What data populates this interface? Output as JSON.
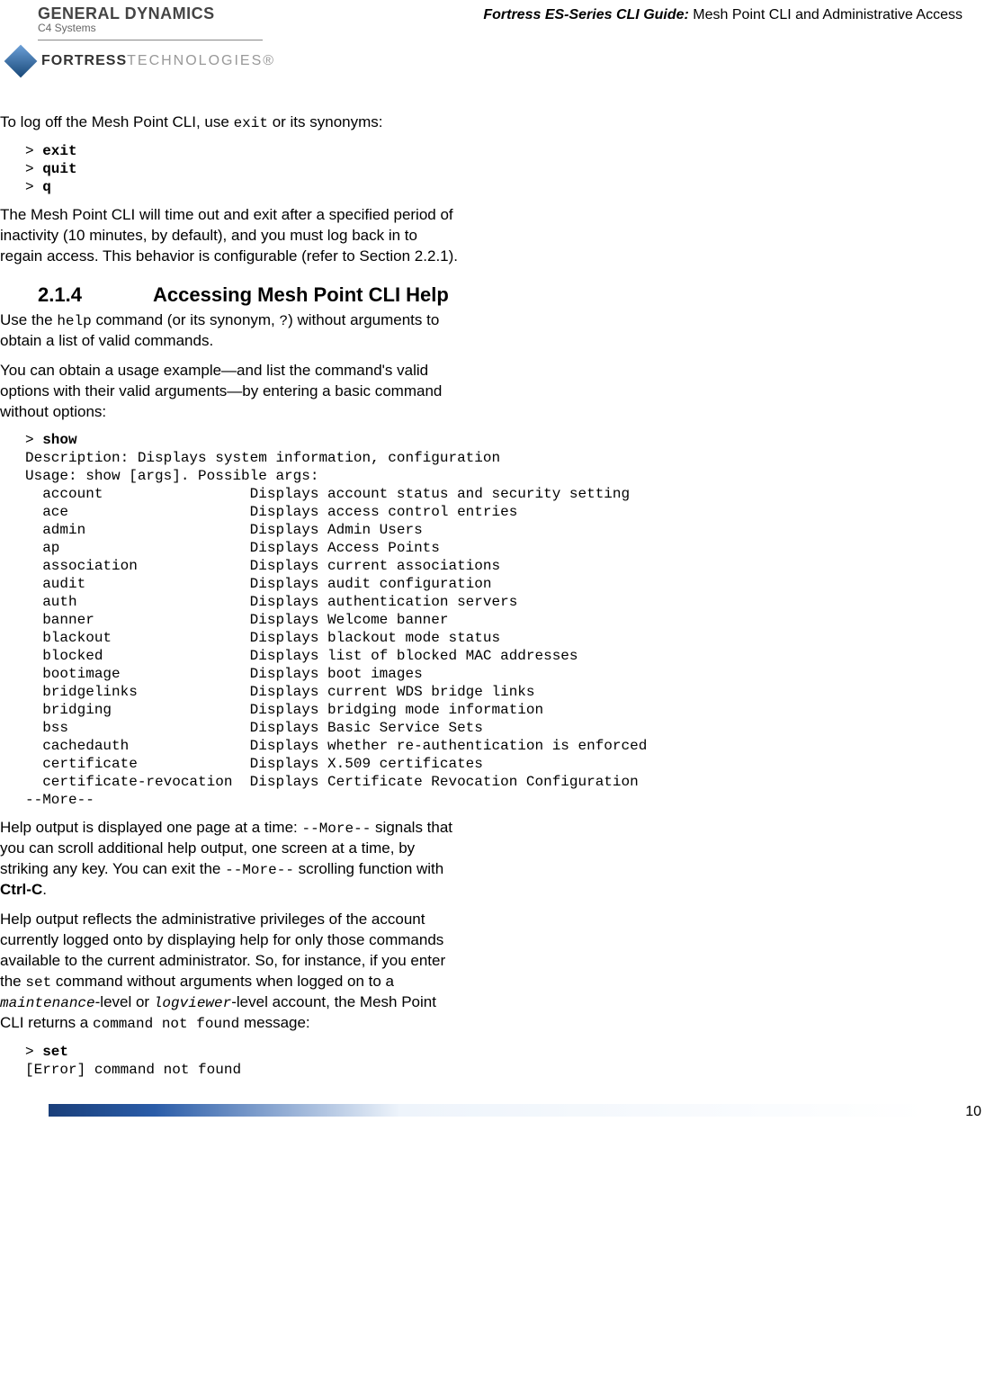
{
  "header": {
    "gd": "GENERAL DYNAMICS",
    "gd_sub": "C4 Systems",
    "fortress": "FORTRESS",
    "fortress_tech": "TECHNOLOGIES®",
    "guide_italic": "Fortress ES-Series CLI Guide:",
    "guide_rest": " Mesh Point CLI and Administrative Access"
  },
  "body": {
    "p1a": "To log off the Mesh Point CLI, use ",
    "p1_code": "exit",
    "p1b": " or its synonyms:",
    "exit_block": "> exit\n> quit\n> q",
    "exit_block_html": [
      {
        "prompt": "> ",
        "cmd": "exit"
      },
      {
        "prompt": "> ",
        "cmd": "quit"
      },
      {
        "prompt": "> ",
        "cmd": "q"
      }
    ],
    "p2": "The Mesh Point CLI will time out and exit after a specified period of inactivity (10 minutes, by default), and you must log back in to regain access. This behavior is configurable (refer to Section 2.2.1).",
    "sec_num": "2.1.4",
    "sec_title": "Accessing Mesh Point CLI Help",
    "p3a": "Use the ",
    "p3_help": "help",
    "p3b": " command (or its synonym, ",
    "p3_q": "?",
    "p3c": ") without arguments to obtain a list of valid commands.",
    "p4": "You can obtain a usage example—and list the command's valid options with their valid arguments—by entering a basic command without options:",
    "show_prompt": "> ",
    "show_cmd": "show",
    "show_output": "Description: Displays system information, configuration\nUsage: show [args]. Possible args:\n  account                 Displays account status and security setting\n  ace                     Displays access control entries\n  admin                   Displays Admin Users\n  ap                      Displays Access Points\n  association             Displays current associations\n  audit                   Displays audit configuration\n  auth                    Displays authentication servers\n  banner                  Displays Welcome banner\n  blackout                Displays blackout mode status\n  blocked                 Displays list of blocked MAC addresses\n  bootimage               Displays boot images\n  bridgelinks             Displays current WDS bridge links\n  bridging                Displays bridging mode information\n  bss                     Displays Basic Service Sets\n  cachedauth              Displays whether re-authentication is enforced\n  certificate             Displays X.509 certificates\n  certificate-revocation  Displays Certificate Revocation Configuration\n--More--",
    "p5a": "Help output is displayed one page at a time: ",
    "p5_more1": "--More--",
    "p5b": " signals that you can scroll additional help output, one screen at a time, by striking any key. You can exit the ",
    "p5_more2": "--More--",
    "p5c": " scrolling function with ",
    "p5_ctrlc": "Ctrl-C",
    "p5d": ".",
    "p6a": "Help output reflects the administrative privileges of the account currently logged onto by displaying help for only those commands available to the current administrator. So, for instance, if you enter the ",
    "p6_set": "set",
    "p6b": " command without arguments when logged on to a ",
    "p6_maint": "maintenance",
    "p6c": "-level or ",
    "p6_logv": "logviewer",
    "p6d": "-level account, the Mesh Point CLI returns a ",
    "p6_cnf": "command not found",
    "p6e": " message:",
    "set_prompt": "> ",
    "set_cmd": "set",
    "set_output": "[Error] command not found"
  },
  "page_number": "10"
}
